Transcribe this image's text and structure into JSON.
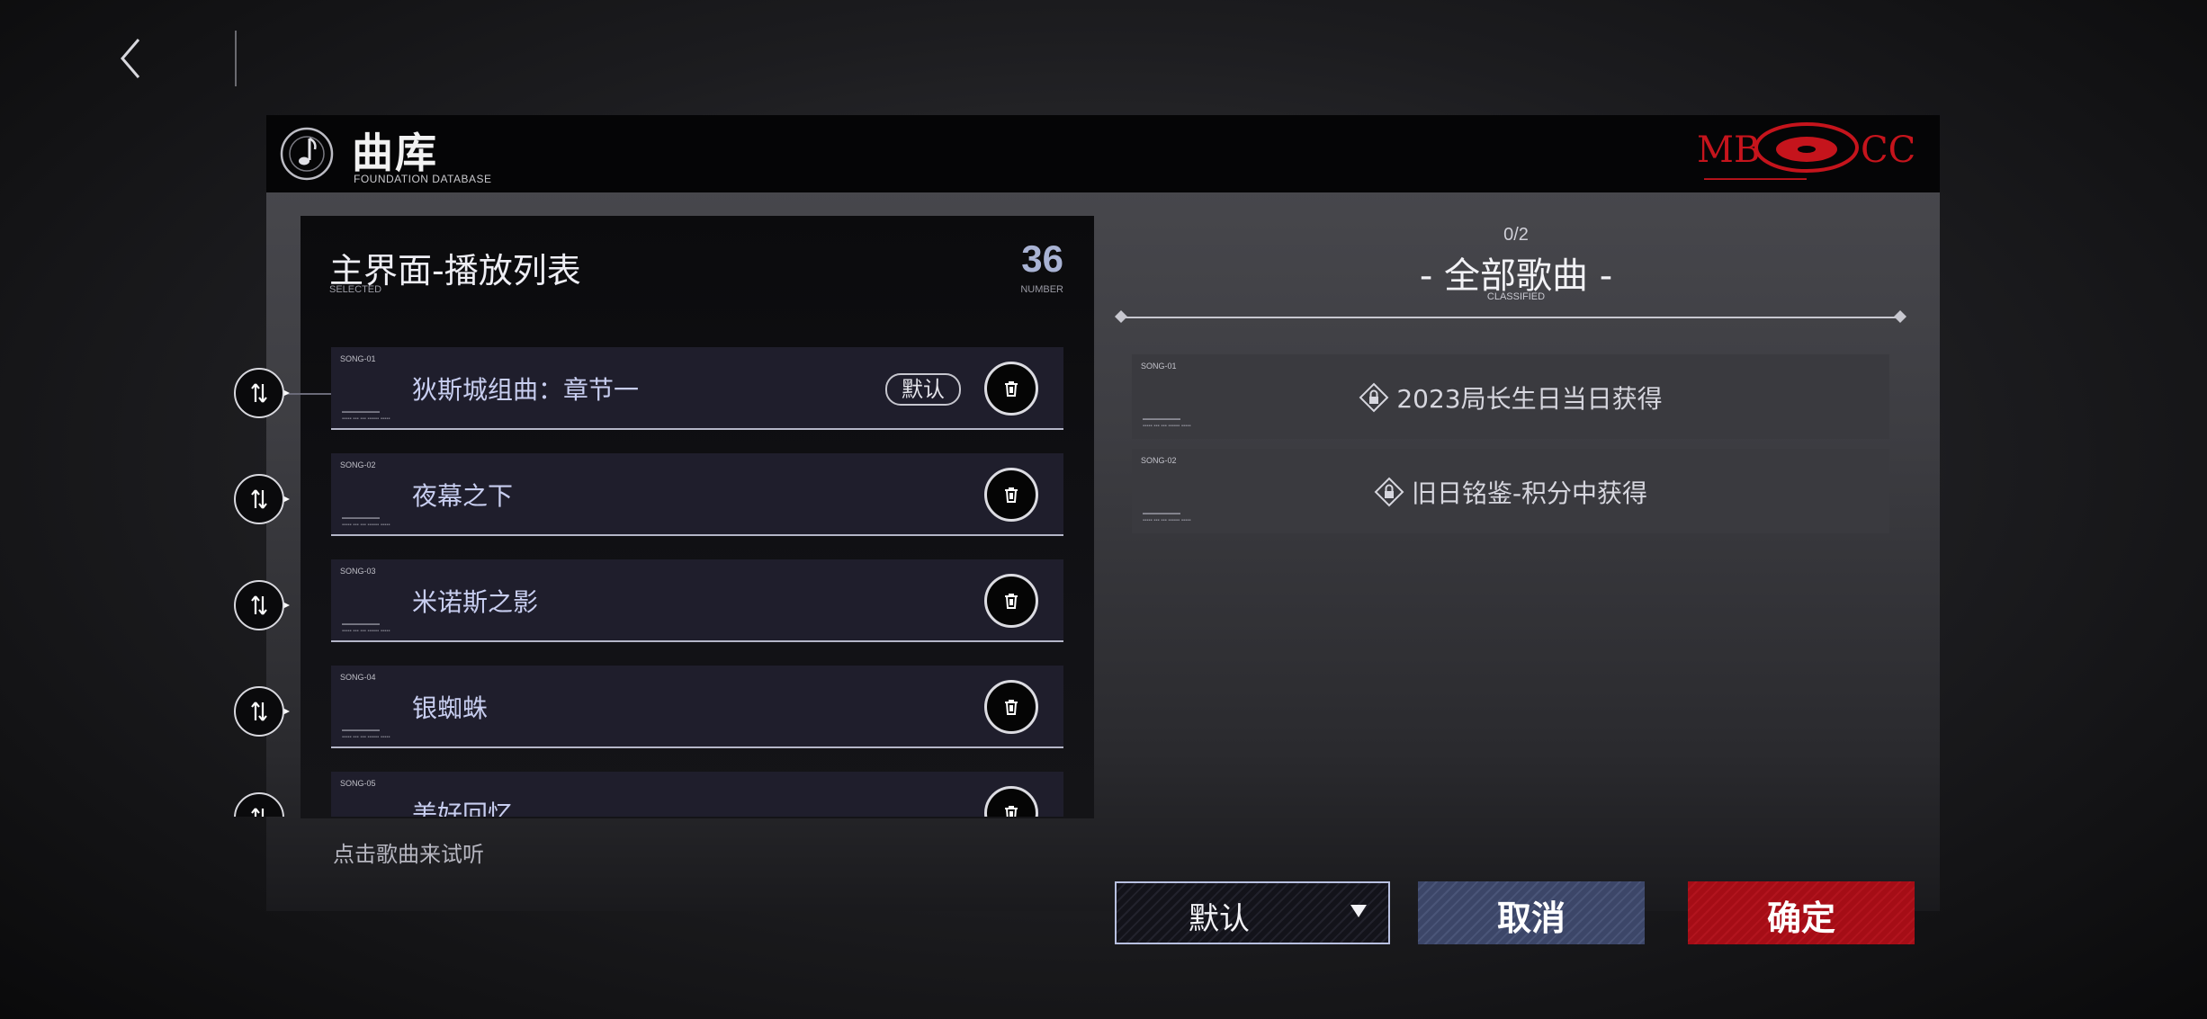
{
  "nav": {
    "back_icon": "chevron-left-icon"
  },
  "header": {
    "title": "曲库",
    "subtitle": "FOUNDATION DATABASE",
    "logo_left": "MB",
    "logo_right": "CC",
    "logo_color": "#c5141c"
  },
  "playlist": {
    "title": "主界面-播放列表",
    "selected_label": "SELECTED",
    "count": "36",
    "number_label": "NUMBER",
    "default_badge": "默认",
    "songs": [
      {
        "id": "SONG-01",
        "name": "狄斯城组曲：章节一",
        "is_default": true
      },
      {
        "id": "SONG-02",
        "name": "夜幕之下",
        "is_default": false
      },
      {
        "id": "SONG-03",
        "name": "米诺斯之影",
        "is_default": false
      },
      {
        "id": "SONG-04",
        "name": "银蜘蛛",
        "is_default": false
      },
      {
        "id": "SONG-05",
        "name": "美好回忆",
        "is_default": false
      }
    ],
    "hint": "点击歌曲来试听"
  },
  "classified": {
    "progress": "0/2",
    "title": "- 全部歌曲 -",
    "subtitle": "CLASSIFIED",
    "items": [
      {
        "id": "SONG-01",
        "source": "2023局长生日当日获得"
      },
      {
        "id": "SONG-02",
        "source": "旧日铭鉴-积分中获得"
      }
    ]
  },
  "footer": {
    "sort_value": "默认",
    "cancel_label": "取消",
    "confirm_label": "确定"
  },
  "colors": {
    "accent_red": "#a50d16",
    "cancel_blue": "#3c4668",
    "song_text": "#c8cef0"
  }
}
